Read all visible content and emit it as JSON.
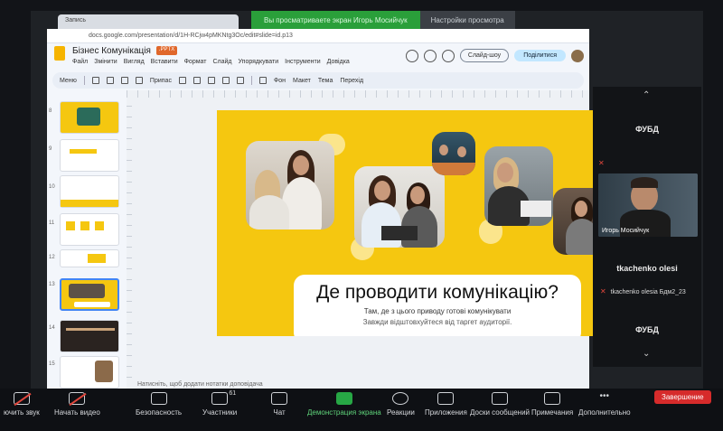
{
  "zoom_banner": {
    "share_status": "Вы просматриваете экран Игорь Мосийчук",
    "share_settings": "Настройки просмотра"
  },
  "browser": {
    "tab_label": "Запись",
    "address": "docs.google.com/presentation/d/1H-RCjw4pMKNtg3Oc/edit#slide=id.p13"
  },
  "slides": {
    "doc_title": "Бізнес Комунікація",
    "file_badge": ".PPTX",
    "menu": [
      "Файл",
      "Змінити",
      "Вигляд",
      "Вставити",
      "Формат",
      "Слайд",
      "Упорядкувати",
      "Інструменти",
      "Довідка"
    ],
    "slideshow_button": "Слайд-шоу",
    "share_button": "Поділитися",
    "toolbar": {
      "menu_label": "Меню",
      "fit_label": "Припас",
      "background_label": "Фон",
      "layout_label": "Макет",
      "theme_label": "Тема",
      "transition_label": "Перехід"
    },
    "thumbnail_numbers": [
      "8",
      "9",
      "10",
      "11",
      "12",
      "13",
      "14",
      "15"
    ],
    "speaker_notes_placeholder": "Натисніть, щоб додати нотатки доповідача"
  },
  "slide": {
    "title": "Де проводити комунікацію?",
    "subtitle": "Там, де з цього приводу готові комунікувати",
    "note": "Завжди відштовхуйтеся від таргет аудиторії.",
    "accent_color": "#f5c710"
  },
  "participants": {
    "label_top": "ФУБД",
    "video_name": "Игорь Мосийчук",
    "name_large": "tkachenko olesi",
    "name_small": "tkachenko olesia Бдм2_23",
    "label_bottom": "ФУБД"
  },
  "zoom_toolbar": {
    "audio": "ючить звук",
    "video": "Начать видео",
    "security": "Безопасность",
    "participants": "Участники",
    "participants_count": "61",
    "chat": "Чат",
    "share": "Демонстрация экрана",
    "reactions": "Реакции",
    "apps": "Приложения",
    "whiteboards": "Доски сообщений",
    "notes": "Примечания",
    "more": "Дополнительно",
    "end": "Завершение"
  }
}
